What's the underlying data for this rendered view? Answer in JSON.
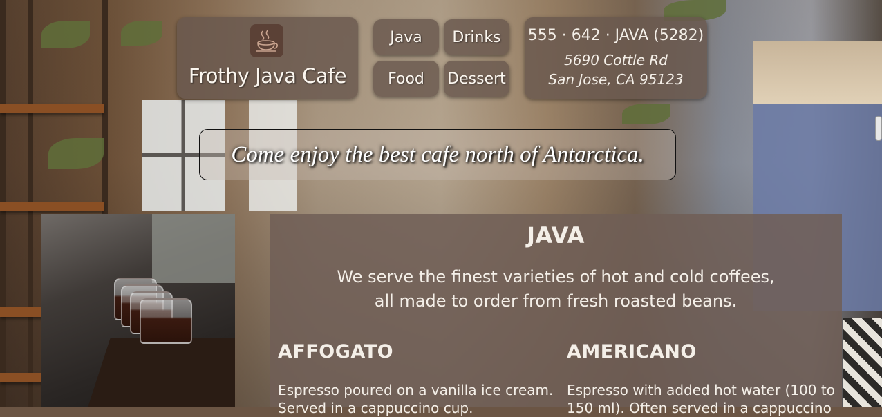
{
  "brand": {
    "name": "Frothy Java Cafe",
    "logo_icon": "coffee-cup-icon"
  },
  "nav": {
    "items": [
      {
        "label": "Java"
      },
      {
        "label": "Drinks"
      },
      {
        "label": "Food"
      },
      {
        "label": "Dessert"
      }
    ]
  },
  "contact": {
    "phone": "555 · 642 · JAVA (5282)",
    "address_line1": "5690 Cottle Rd",
    "address_line2": "San Jose, CA 95123"
  },
  "tagline": "Come enjoy the best cafe north of Antarctica.",
  "section": {
    "title": "JAVA",
    "intro": "We serve the finest varieties of hot and cold coffees, all made to order from fresh roasted beans.",
    "items": [
      {
        "name": "AFFOGATO",
        "description": "Espresso poured on a vanilla ice cream. Served in a cappuccino cup."
      },
      {
        "name": "AMERICANO",
        "description": "Espresso with added hot water (100 to 150 ml). Often served in a cappuccino"
      }
    ]
  },
  "colors": {
    "panel": "#69584e",
    "text": "#f4efe8",
    "logo_bg": "#5b4136"
  }
}
